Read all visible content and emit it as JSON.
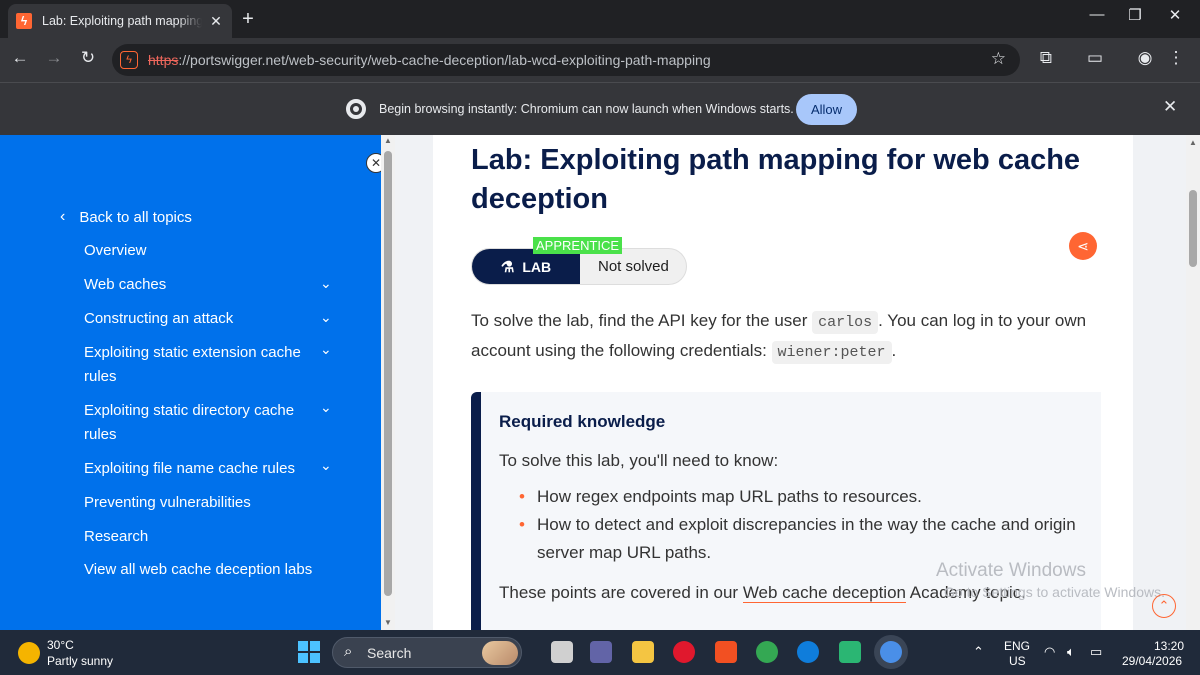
{
  "browser": {
    "tab_title": "Lab: Exploiting path mapping for web cache deception",
    "new_tab_label": "+",
    "url_scheme": "https",
    "url_rest": "://portswigger.net/web-security/web-cache-deception/lab-wcd-exploiting-path-mapping"
  },
  "infobar": {
    "message": "Begin browsing instantly: Chromium can now launch when Windows starts.",
    "allow_label": "Allow"
  },
  "sidebar": {
    "back_label": "Back to all topics",
    "items": [
      {
        "label": "Overview",
        "expandable": false
      },
      {
        "label": "Web caches",
        "expandable": true
      },
      {
        "label": "Constructing an attack",
        "expandable": true
      },
      {
        "label": "Exploiting static extension cache rules",
        "expandable": true
      },
      {
        "label": "Exploiting static directory cache rules",
        "expandable": true
      },
      {
        "label": "Exploiting file name cache rules",
        "expandable": true
      },
      {
        "label": "Preventing vulnerabilities",
        "expandable": false
      },
      {
        "label": "Research",
        "expandable": false
      },
      {
        "label": "View all web cache deception labs",
        "expandable": false
      }
    ]
  },
  "main": {
    "title": "Lab: Exploiting path mapping for web cache deception",
    "level_badge": "APPRENTICE",
    "lab_label": "LAB",
    "status": "Not solved",
    "intro_part1": "To solve the lab, find the API key for the user ",
    "intro_code1": "carlos",
    "intro_part2": ". You can log in to your own account using the following credentials: ",
    "intro_code2": "wiener:peter",
    "intro_part3": ".",
    "knowledge": {
      "title": "Required knowledge",
      "intro": "To solve this lab, you'll need to know:",
      "bullets": [
        "How regex endpoints map URL paths to resources.",
        "How to detect and exploit discrepancies in the way the cache and origin server map URL paths."
      ],
      "footer_prefix": "These points are covered in our ",
      "footer_link": "Web cache deception",
      "footer_suffix": " Academy topic."
    }
  },
  "watermark": {
    "line1": "Activate Windows",
    "line2": "Go to Settings to activate Windows."
  },
  "taskbar": {
    "temperature": "30°C",
    "weather": "Partly sunny",
    "search_label": "Search",
    "lang_1": "ENG",
    "lang_2": "US",
    "time": "13:20",
    "date": "29/04/2026"
  },
  "colors": {
    "accent": "#ff6633",
    "sidebar": "#0071eb",
    "navy": "#0a1d4a",
    "badge_green": "#4ae14a"
  }
}
